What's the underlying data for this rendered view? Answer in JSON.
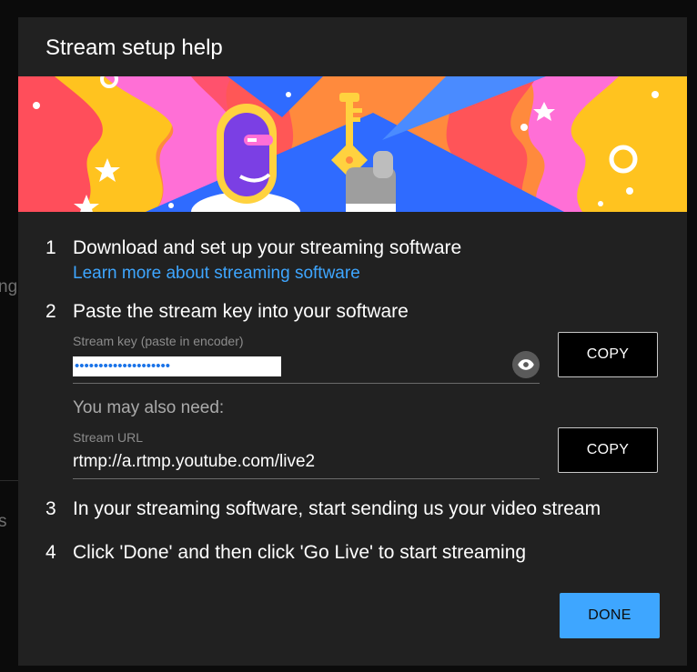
{
  "background": {
    "fragment_1": "ng",
    "fragment_2": "s"
  },
  "dialog": {
    "title": "Stream setup help",
    "steps": [
      {
        "number": "1",
        "text": "Download and set up your streaming software"
      },
      {
        "number": "2",
        "text": "Paste the stream key into your software"
      },
      {
        "number": "3",
        "text": "In your streaming software, start sending us your video stream"
      },
      {
        "number": "4",
        "text": "Click 'Done' and then click 'Go Live' to start streaming"
      }
    ],
    "learn_more_link": "Learn more about streaming software",
    "stream_key": {
      "label": "Stream key (paste in encoder)",
      "masked_value": "••••••••••••••••••••",
      "reveal_icon": "eye-icon"
    },
    "also_need": "You may also need:",
    "stream_url": {
      "label": "Stream URL",
      "value": "rtmp://a.rtmp.youtube.com/live2"
    },
    "copy_label": "COPY",
    "done_label": "DONE"
  },
  "colors": {
    "dialog_bg": "#212121",
    "accent": "#3ea6ff",
    "link": "#3ea6ff"
  }
}
